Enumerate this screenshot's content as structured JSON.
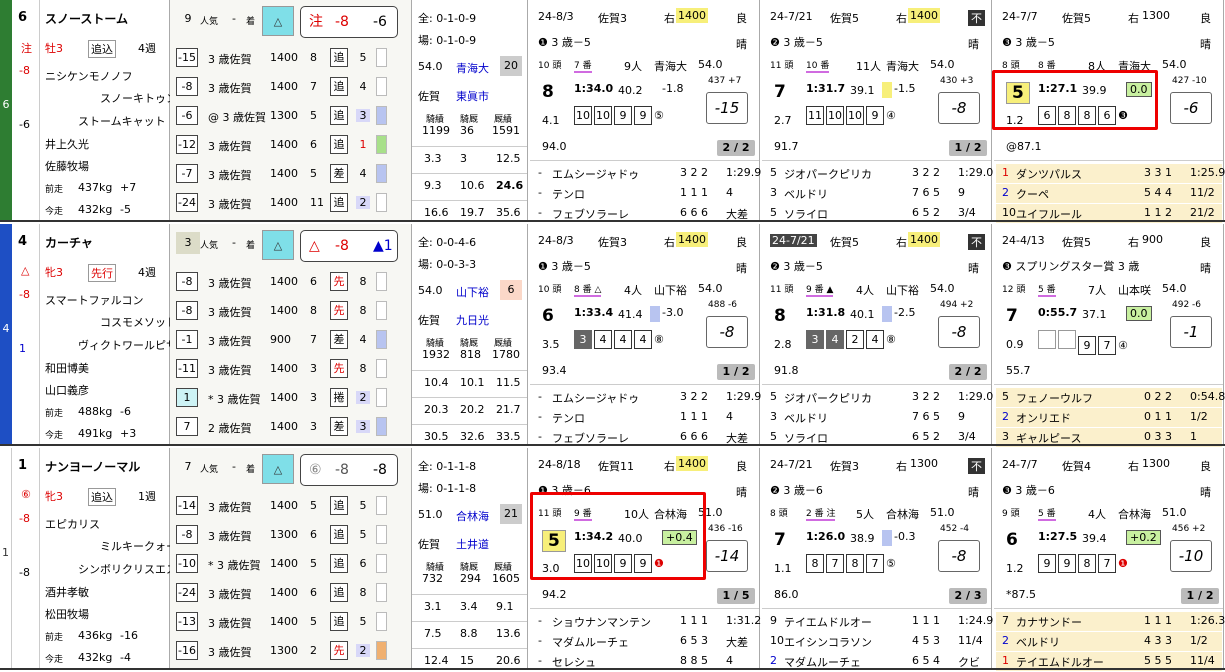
{
  "horses": [
    {
      "post": "6",
      "num": "6",
      "name": "スノーストーム",
      "sym": "注",
      "odds_diff": "-8",
      "pos_note": "-6",
      "sex_age": "牡3",
      "style": "追込",
      "weeks": "4週",
      "sire": "ニシケンモノノフ",
      "dam": "スノーキトゥン",
      "damsire": "ストームキャット",
      "jockey": "井上久光",
      "trainer": "佐藤牧場",
      "prev_label": "前走",
      "prev_w": "437kg",
      "prev_d": "+7",
      "cur_label": "今走",
      "cur_w": "432kg",
      "cur_d": "-5",
      "pop": "9",
      "pop_label": "人気",
      "chaku": "-",
      "chaku_label": "着",
      "mark_sym": "注",
      "mark_a": "-8",
      "mark_b": "-6",
      "recs": [
        {
          "a": "-15",
          "b": "3 歳佐賀",
          "c": "1400",
          "d": "8",
          "e": "追",
          "f": "5"
        },
        {
          "a": "-8",
          "b": "3 歳佐賀",
          "c": "1400",
          "d": "7",
          "e": "追",
          "f": "4"
        },
        {
          "a": "-6",
          "b": "@ 3 歳佐賀",
          "c": "1300",
          "d": "5",
          "e": "追",
          "f": "3"
        },
        {
          "a": "-12",
          "b": "3 歳佐賀",
          "c": "1400",
          "d": "6",
          "e": "追",
          "f": "1"
        },
        {
          "a": "-7",
          "b": "3 歳佐賀",
          "c": "1400",
          "d": "5",
          "e": "差",
          "f": "4"
        },
        {
          "a": "-24",
          "b": "3 歳佐賀",
          "c": "1400",
          "d": "11",
          "e": "追",
          "f": "2"
        }
      ],
      "st": {
        "all": "全: 0-1-0-9",
        "place": "場: 0-1-0-9",
        "v1": "54.0",
        "jock": "青海大",
        "v2": "20",
        "loc": "佐賀",
        "trn": "東眞市",
        "h1": "騎績",
        "h2": "騎厩",
        "h3": "厩績",
        "n1": "1199",
        "n2": "36",
        "n3": "1591",
        "r1": [
          "3.3",
          "3",
          "12.5"
        ],
        "r2": [
          "9.3",
          "10.6",
          "24.6"
        ],
        "r3": [
          "16.6",
          "19.7",
          "35.6"
        ]
      },
      "races": [
        {
          "date": "24-8/3",
          "venue": "佐賀3",
          "dir": "右",
          "dist": "1400",
          "cond": "良",
          "cls": "❶ 3 歳－5",
          "weather": "晴",
          "heads": "10 頭",
          "gate": "7 番",
          "pop": "9人",
          "jk": "青海大",
          "wt": "54.0",
          "pos": "8",
          "time": "1:34.0",
          "f3": "40.2",
          "diff": "-1.8",
          "wt2": "437 +7",
          "sc": "-15",
          "sub": "4.1",
          "c": [
            "10",
            "10",
            "9",
            "9"
          ],
          "cm": "⑤",
          "rate": "94.0",
          "frac": "2 / 2",
          "l": [
            {
              "n": "-",
              "h": "エムシージャドゥ",
              "c": "3 2 2",
              "t": "1:29.9"
            },
            {
              "n": "-",
              "h": "テンロ",
              "c": "1 1 1",
              "t": "4"
            },
            {
              "n": "-",
              "h": "フェブソラーレ",
              "c": "6 6 6",
              "t": "大差"
            }
          ]
        },
        {
          "date": "24-7/21",
          "venue": "佐賀5",
          "dir": "右",
          "dist": "1400",
          "cond": "不",
          "cls": "❷ 3 歳－5",
          "weather": "晴",
          "heads": "11 頭",
          "gate": "10 番",
          "pop": "11人",
          "jk": "青海大",
          "wt": "54.0",
          "pos": "7",
          "time": "1:31.7",
          "f3": "39.1",
          "diff": "-1.5",
          "wt2": "430 +3",
          "sc": "-8",
          "sub": "2.7",
          "c": [
            "11",
            "10",
            "10",
            "9"
          ],
          "cm": "④",
          "rate": "91.7",
          "frac": "1 / 2",
          "l": [
            {
              "n": "5",
              "h": "ジオパークピリカ",
              "c": "3 2 2",
              "t": "1:29.0"
            },
            {
              "n": "3",
              "h": "ベルドリ",
              "c": "7 6 5",
              "t": "9"
            },
            {
              "n": "5",
              "h": "ソライロ",
              "c": "6 5 2",
              "t": "3/4"
            }
          ]
        },
        {
          "date": "24-7/7",
          "venue": "佐賀5",
          "dir": "右",
          "dist": "1300",
          "cond": "良",
          "cls": "❸ 3 歳－5",
          "weather": "晴",
          "heads": "8 頭",
          "gate": "8 番",
          "pop": "8人",
          "jk": "青海大",
          "wt": "54.0",
          "pos": "5",
          "time": "1:27.1",
          "f3": "39.9",
          "diff": "0.0",
          "wt2": "427 -10",
          "sc": "-6",
          "sub": "1.2",
          "c": [
            "6",
            "8",
            "8",
            "6"
          ],
          "cm": "❸",
          "rate": "@87.1",
          "frac": "",
          "l": [
            {
              "n": "1",
              "h": "ダンツパルス",
              "c": "3 3 1",
              "t": "1:25.9"
            },
            {
              "n": "2",
              "h": "クーペ",
              "c": "5 4 4",
              "t": "11/2"
            },
            {
              "n": "10",
              "h": "ユイフルール",
              "c": "1 1 2",
              "t": "21/2"
            }
          ]
        }
      ]
    },
    {
      "post": "4",
      "num": "4",
      "name": "カーチャ",
      "sym": "△",
      "odds_diff": "-8",
      "pos_note": "1",
      "sex_age": "牝3",
      "style": "先行",
      "weeks": "4週",
      "sire": "スマートファルコン",
      "dam": "コスモメソッド",
      "damsire": "ヴィクトワールピサ",
      "jockey": "和田博美",
      "trainer": "山口義彦",
      "prev_label": "前走",
      "prev_w": "488kg",
      "prev_d": "-6",
      "cur_label": "今走",
      "cur_w": "491kg",
      "cur_d": "+3",
      "pop": "3",
      "pop_label": "人気",
      "chaku": "-",
      "chaku_label": "着",
      "mark_sym": "△",
      "mark_a": "-8",
      "mark_b": "▲1",
      "recs": [
        {
          "a": "-8",
          "b": "3 歳佐賀",
          "c": "1400",
          "d": "6",
          "e": "先",
          "f": "8"
        },
        {
          "a": "-8",
          "b": "3 歳佐賀",
          "c": "1400",
          "d": "8",
          "e": "先",
          "f": "8"
        },
        {
          "a": "-1",
          "b": "3 歳佐賀",
          "c": "900",
          "d": "7",
          "e": "差",
          "f": "4"
        },
        {
          "a": "-11",
          "b": "3 歳佐賀",
          "c": "1400",
          "d": "3",
          "e": "先",
          "f": "8"
        },
        {
          "a": "1",
          "b": "* 3 歳佐賀",
          "c": "1400",
          "d": "3",
          "e": "捲",
          "f": "2"
        },
        {
          "a": "7",
          "b": "2 歳佐賀",
          "c": "1400",
          "d": "3",
          "e": "差",
          "f": "3"
        }
      ],
      "st": {
        "all": "全: 0-0-4-6",
        "place": "場: 0-0-3-3",
        "v1": "54.0",
        "jock": "山下裕",
        "v2": "6",
        "loc": "佐賀",
        "trn": "九日光",
        "h1": "騎績",
        "h2": "騎厩",
        "h3": "厩績",
        "n1": "1932",
        "n2": "818",
        "n3": "1780",
        "r1": [
          "10.4",
          "10.1",
          "11.5"
        ],
        "r2": [
          "20.3",
          "20.2",
          "21.7"
        ],
        "r3": [
          "30.5",
          "32.6",
          "33.5"
        ]
      },
      "races": [
        {
          "date": "24-8/3",
          "venue": "佐賀3",
          "dir": "右",
          "dist": "1400",
          "cond": "良",
          "cls": "❶ 3 歳－5",
          "weather": "晴",
          "heads": "10 頭",
          "gate": "8 番 △",
          "pop": "4人",
          "jk": "山下裕",
          "wt": "54.0",
          "pos": "6",
          "time": "1:33.4",
          "f3": "41.4",
          "diff": "-3.0",
          "wt2": "488 -6",
          "sc": "-8",
          "sub": "3.5",
          "c": [
            "3",
            "4",
            "4",
            "4"
          ],
          "cm": "⑧",
          "rate": "93.4",
          "frac": "1 / 2",
          "l": [
            {
              "n": "-",
              "h": "エムシージャドゥ",
              "c": "3 2 2",
              "t": "1:29.9"
            },
            {
              "n": "-",
              "h": "テンロ",
              "c": "1 1 1",
              "t": "4"
            },
            {
              "n": "-",
              "h": "フェブソラーレ",
              "c": "6 6 6",
              "t": "大差"
            }
          ]
        },
        {
          "date": "24-7/21",
          "venue": "佐賀5",
          "dir": "右",
          "dist": "1400",
          "cond": "不",
          "cls": "❷ 3 歳－5",
          "weather": "晴",
          "heads": "11 頭",
          "gate": "9 番 ▲",
          "pop": "4人",
          "jk": "山下裕",
          "wt": "54.0",
          "pos": "8",
          "time": "1:31.8",
          "f3": "40.1",
          "diff": "-2.5",
          "wt2": "494 +2",
          "sc": "-8",
          "sub": "2.8",
          "c": [
            "3",
            "4",
            "2",
            "4"
          ],
          "cm": "⑧",
          "rate": "91.8",
          "frac": "2 / 2",
          "l": [
            {
              "n": "5",
              "h": "ジオパークピリカ",
              "c": "3 2 2",
              "t": "1:29.0"
            },
            {
              "n": "3",
              "h": "ベルドリ",
              "c": "7 6 5",
              "t": "9"
            },
            {
              "n": "5",
              "h": "ソライロ",
              "c": "6 5 2",
              "t": "3/4"
            }
          ]
        },
        {
          "date": "24-4/13",
          "venue": "佐賀5",
          "dir": "右",
          "dist": "900",
          "cond": "良",
          "cls": "❸ スプリングスター賞 3 歳",
          "weather": "晴",
          "heads": "12 頭",
          "gate": "5 番",
          "pop": "7人",
          "jk": "山本咲",
          "wt": "54.0",
          "pos": "7",
          "time": "0:55.7",
          "f3": "37.1",
          "diff": "0.0",
          "wt2": "492 -6",
          "sc": "-1",
          "sub": "0.9",
          "c": [
            "",
            "",
            "9",
            "7"
          ],
          "cm": "④",
          "rate": "55.7",
          "frac": "",
          "l": [
            {
              "n": "5",
              "h": "フェノーウルフ",
              "c": "0 2 2",
              "t": "0:54.8"
            },
            {
              "n": "2",
              "h": "オンリエド",
              "c": "0 1 1",
              "t": "1/2"
            },
            {
              "n": "3",
              "h": "ギャルピース",
              "c": "0 3 3",
              "t": "1"
            }
          ]
        }
      ]
    },
    {
      "post": "1",
      "num": "1",
      "name": "ナンヨーノーマル",
      "sym": "⑥",
      "odds_diff": "-8",
      "pos_note": "-8",
      "sex_age": "牝3",
      "style": "追込",
      "weeks": "1週",
      "sire": "エピカリス",
      "dam": "ミルキークォーツ",
      "damsire": "シンボリクリスエス",
      "jockey": "酒井孝敏",
      "trainer": "松田牧場",
      "prev_label": "前走",
      "prev_w": "436kg",
      "prev_d": "-16",
      "cur_label": "今走",
      "cur_w": "432kg",
      "cur_d": "-4",
      "pop": "7",
      "pop_label": "人気",
      "chaku": "-",
      "chaku_label": "着",
      "mark_sym": "⑥",
      "mark_a": "-8",
      "mark_b": "-8",
      "recs": [
        {
          "a": "-14",
          "b": "3 歳佐賀",
          "c": "1400",
          "d": "5",
          "e": "追",
          "f": "5"
        },
        {
          "a": "-8",
          "b": "3 歳佐賀",
          "c": "1300",
          "d": "6",
          "e": "追",
          "f": "5"
        },
        {
          "a": "-10",
          "b": "* 3 歳佐賀",
          "c": "1400",
          "d": "5",
          "e": "追",
          "f": "6"
        },
        {
          "a": "-24",
          "b": "3 歳佐賀",
          "c": "1400",
          "d": "6",
          "e": "追",
          "f": "8"
        },
        {
          "a": "-13",
          "b": "3 歳佐賀",
          "c": "1400",
          "d": "5",
          "e": "追",
          "f": "5"
        },
        {
          "a": "-16",
          "b": "3 歳佐賀",
          "c": "1300",
          "d": "2",
          "e": "先",
          "f": "2"
        }
      ],
      "st": {
        "all": "全: 0-1-1-8",
        "place": "場: 0-1-1-8",
        "v1": "51.0",
        "jock": "合林海",
        "v2": "21",
        "loc": "佐賀",
        "trn": "土井道",
        "h1": "騎績",
        "h2": "騎厩",
        "h3": "厩績",
        "n1": "732",
        "n2": "294",
        "n3": "1605",
        "r1": [
          "3.1",
          "3.4",
          "9.1"
        ],
        "r2": [
          "7.5",
          "8.8",
          "13.6"
        ],
        "r3": [
          "12.4",
          "15",
          "20.6"
        ]
      },
      "races": [
        {
          "date": "24-8/18",
          "venue": "佐賀11",
          "dir": "右",
          "dist": "1400",
          "cond": "良",
          "cls": "❶ 3 歳－6",
          "weather": "晴",
          "heads": "11 頭",
          "gate": "9 番",
          "pop": "10人",
          "jk": "合林海",
          "wt": "51.0",
          "pos": "5",
          "time": "1:34.2",
          "f3": "40.0",
          "diff": "+0.4",
          "wt2": "436 -16",
          "sc": "-14",
          "sub": "3.0",
          "c": [
            "10",
            "10",
            "9",
            "9"
          ],
          "cm": "❶",
          "rate": "94.2",
          "frac": "1 / 5",
          "l": [
            {
              "n": "-",
              "h": "ショウナンマンテン",
              "c": "1 1 1",
              "t": "1:31.2"
            },
            {
              "n": "-",
              "h": "マダムルーチェ",
              "c": "6 5 3",
              "t": "大差"
            },
            {
              "n": "-",
              "h": "セレシュ",
              "c": "8 8 5",
              "t": "4"
            }
          ]
        },
        {
          "date": "24-7/21",
          "venue": "佐賀3",
          "dir": "右",
          "dist": "1300",
          "cond": "不",
          "cls": "❷ 3 歳－6",
          "weather": "晴",
          "heads": "8 頭",
          "gate": "2 番 注",
          "pop": "5人",
          "jk": "合林海",
          "wt": "51.0",
          "pos": "7",
          "time": "1:26.0",
          "f3": "38.9",
          "diff": "-0.3",
          "wt2": "452 -4",
          "sc": "-8",
          "sub": "1.1",
          "c": [
            "8",
            "7",
            "8",
            "7"
          ],
          "cm": "⑤",
          "rate": "86.0",
          "frac": "2 / 3",
          "l": [
            {
              "n": "9",
              "h": "テイエムドルオー",
              "c": "1 1 1",
              "t": "1:24.9"
            },
            {
              "n": "10",
              "h": "エイシンコラソン",
              "c": "4 5 3",
              "t": "11/4"
            },
            {
              "n": "2",
              "h": "マダムルーチェ",
              "c": "6 5 4",
              "t": "クビ"
            }
          ]
        },
        {
          "date": "24-7/7",
          "venue": "佐賀4",
          "dir": "右",
          "dist": "1300",
          "cond": "良",
          "cls": "❸ 3 歳－6",
          "weather": "晴",
          "heads": "9 頭",
          "gate": "5 番",
          "pop": "4人",
          "jk": "合林海",
          "wt": "51.0",
          "pos": "6",
          "time": "1:27.5",
          "f3": "39.4",
          "diff": "+0.2",
          "wt2": "456 +2",
          "sc": "-10",
          "sub": "1.2",
          "c": [
            "9",
            "9",
            "8",
            "7"
          ],
          "cm": "❶",
          "rate": "*87.5",
          "frac": "1 / 2",
          "l": [
            {
              "n": "7",
              "h": "カナサンドー",
              "c": "1 1 1",
              "t": "1:26.3"
            },
            {
              "n": "2",
              "h": "ベルドリ",
              "c": "4 3 3",
              "t": "1/2"
            },
            {
              "n": "1",
              "h": "テイエムドルオー",
              "c": "5 5 5",
              "t": "11/4"
            }
          ]
        }
      ]
    }
  ],
  "colors": {
    "post6": "#2e7d32",
    "post4": "#1e4fc4",
    "post1": "#ffffff",
    "highlight": "#ee0000",
    "teal_box": "#7fdfe8",
    "green_box": "#c8f0a0",
    "yellow_box": "#f7ef7a"
  }
}
